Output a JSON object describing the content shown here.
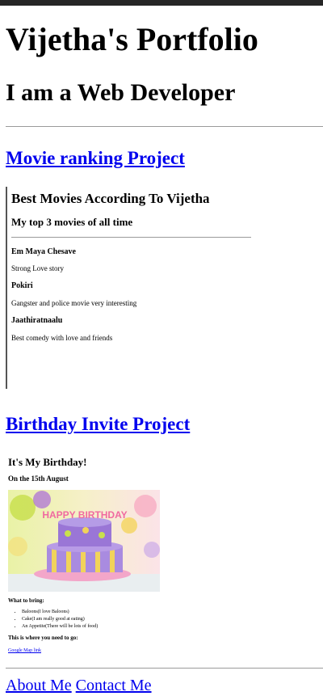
{
  "header": {
    "title": "Vijetha's Portfolio",
    "subtitle": "I am a Web Developer"
  },
  "projects": {
    "movie_link": "Movie ranking Project",
    "birthday_link": "Birthday Invite Project"
  },
  "movie_page": {
    "title": "Best Movies According To Vijetha",
    "subtitle": "My top 3 movies of all time",
    "movies": [
      {
        "name": "Em Maya Chesave",
        "desc": "Strong Love story"
      },
      {
        "name": "Pokiri",
        "desc": "Gangster and police movie very interesting"
      },
      {
        "name": "Jaathiratnaalu",
        "desc": "Best comedy with love and friends"
      }
    ]
  },
  "birthday_page": {
    "title": "It's My Birthday!",
    "subtitle": "On the 15th August",
    "cake_text": "HAPPY BIRTHDAY",
    "bring_heading": "What to bring:",
    "items": [
      "Baloons(I love Baloons)",
      "Cake(I am really good at eating)",
      "An Appetite(There will be lots of food)"
    ],
    "where_heading": "This is where you need to go:",
    "map_link": "Google Map link"
  },
  "footer": {
    "about": "About Me",
    "contact": "Contact Me"
  },
  "colors": {
    "link": "#0000ee",
    "topbar": "#262626"
  }
}
